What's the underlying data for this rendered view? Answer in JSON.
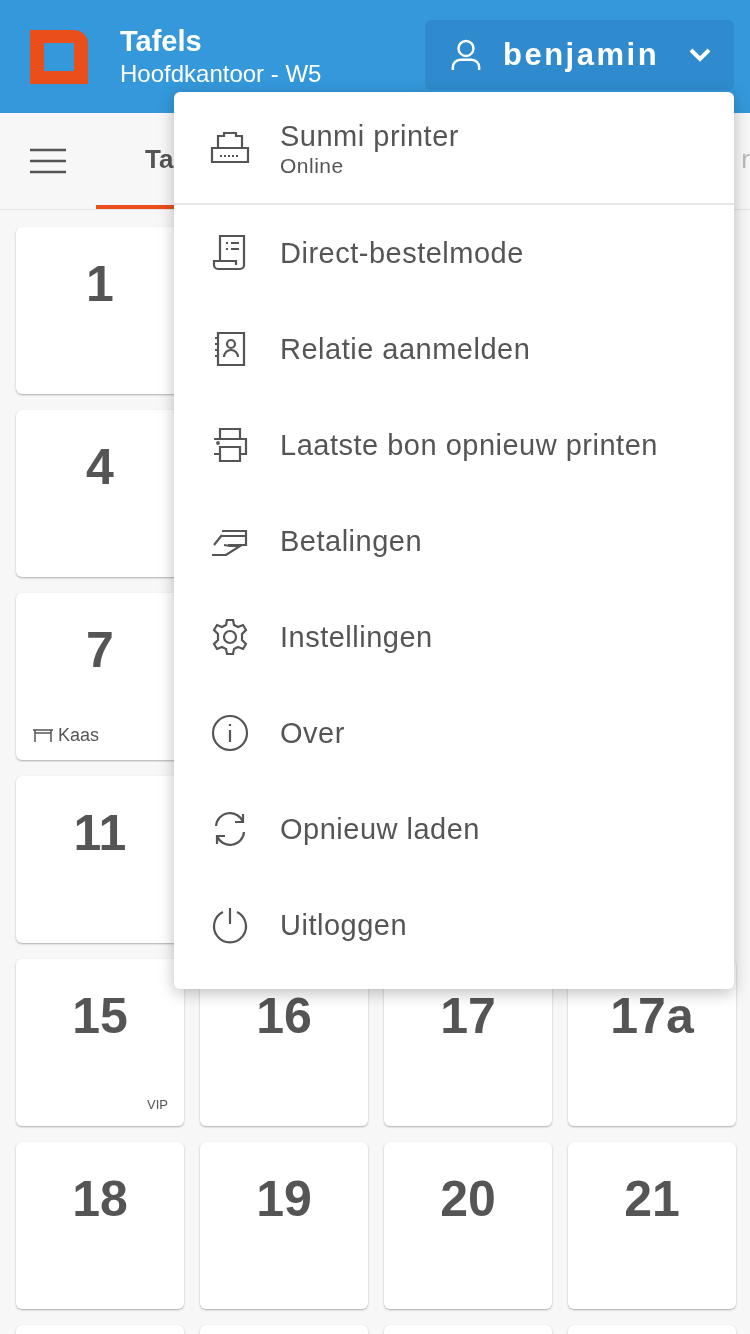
{
  "header": {
    "title": "Tafels",
    "subtitle": "Hoofdkantoor - W5",
    "user": {
      "name": "benjamin",
      "expanded": true
    }
  },
  "tabs": [
    {
      "label": "Ta",
      "selected": true
    },
    {
      "label": "r",
      "selected": false
    }
  ],
  "table_rows": [
    {
      "tables": [
        {
          "number": "1"
        }
      ]
    },
    {
      "tables": [
        {
          "number": "4"
        }
      ]
    },
    {
      "tables": [
        {
          "number": "7",
          "note": {
            "kind": "reservation",
            "text": "Kaas"
          }
        }
      ]
    },
    {
      "tables": [
        {
          "number": "11"
        }
      ]
    },
    {
      "tables": [
        {
          "number": "15",
          "note": {
            "kind": "tag",
            "text": "VIP"
          }
        },
        {
          "number": "16"
        },
        {
          "number": "17"
        },
        {
          "number": "17a"
        }
      ]
    },
    {
      "tables": [
        {
          "number": "18"
        },
        {
          "number": "19"
        },
        {
          "number": "20"
        },
        {
          "number": "21"
        }
      ]
    }
  ],
  "user_menu": [
    {
      "kind": "printer",
      "label": "Sunmi printer",
      "status": "Online"
    },
    {
      "kind": "receipt",
      "label": "Direct-bestelmode"
    },
    {
      "kind": "contact",
      "label": "Relatie aanmelden"
    },
    {
      "kind": "print",
      "label": "Laatste bon opnieuw printen"
    },
    {
      "kind": "payment",
      "label": "Betalingen"
    },
    {
      "kind": "settings",
      "label": "Instellingen"
    },
    {
      "kind": "info",
      "label": "Over"
    },
    {
      "kind": "reload",
      "label": "Opnieuw laden"
    },
    {
      "kind": "power",
      "label": "Uitloggen"
    }
  ]
}
